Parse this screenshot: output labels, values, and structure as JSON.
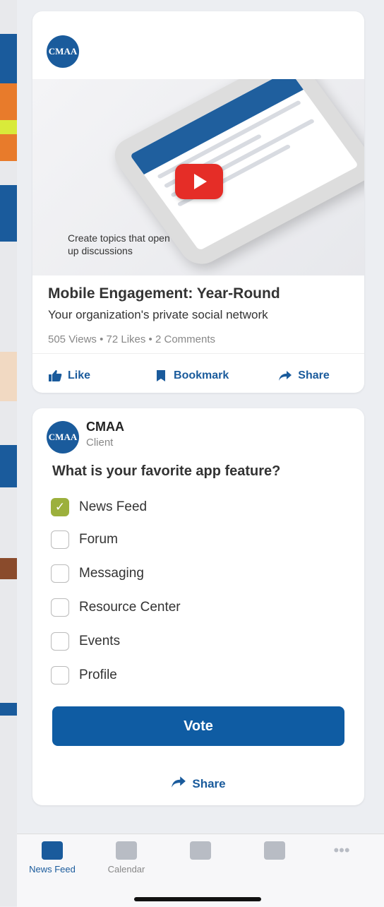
{
  "colors": {
    "brand": "#1a5b9c",
    "vote_button": "#0f5ca3",
    "checked": "#9cb03c",
    "youtube_red": "#e52d27"
  },
  "post1": {
    "author_avatar_text": "CMAA",
    "video_caption": "Create topics that open up discussions",
    "title": "Mobile Engagement: Year-Round",
    "description": "Your organization's private social network",
    "stats": "505 Views  •  72 Likes  •  2 Comments",
    "actions": {
      "like": "Like",
      "bookmark": "Bookmark",
      "share": "Share"
    }
  },
  "post2": {
    "author": "CMAA",
    "author_avatar_text": "CMAA",
    "subtitle": "Client",
    "question": "What is your favorite app feature?",
    "options": [
      {
        "label": "News Feed",
        "checked": true
      },
      {
        "label": "Forum",
        "checked": false
      },
      {
        "label": "Messaging",
        "checked": false
      },
      {
        "label": "Resource Center",
        "checked": false
      },
      {
        "label": "Events",
        "checked": false
      },
      {
        "label": "Profile",
        "checked": false
      }
    ],
    "vote_label": "Vote",
    "share_label": "Share"
  },
  "tabbar": {
    "items": [
      {
        "label": "News Feed",
        "icon": "news-feed-icon",
        "active": true
      },
      {
        "label": "Calendar",
        "icon": "calendar-icon",
        "active": false
      },
      {
        "label": "",
        "icon": "book-icon",
        "active": false
      },
      {
        "label": "",
        "icon": "handshake-icon",
        "active": false
      },
      {
        "label": "",
        "icon": "more-icon",
        "active": false
      }
    ]
  }
}
